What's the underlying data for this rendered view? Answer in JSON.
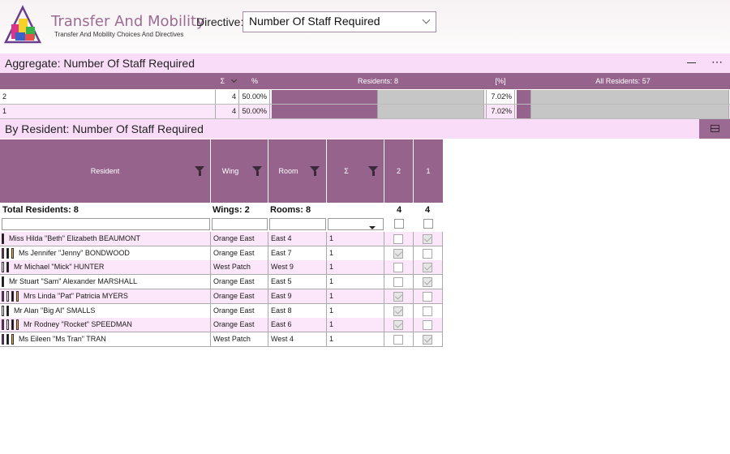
{
  "app": {
    "title": "Transfer And Mobility",
    "subtitle": "Transfer And Mobility Choices And Directives"
  },
  "directive": {
    "label": "Directive:",
    "value": "Number Of Staff Required"
  },
  "aggregate": {
    "title": "Aggregate: Number Of Staff Required",
    "headers": {
      "sum": "Σ",
      "pct": "%",
      "residents": "Residents: 8",
      "bracket_pct": "[%]",
      "all_residents": "All Residents: 57"
    },
    "rows": [
      {
        "key": "2",
        "count": "4",
        "pct": "50.00%",
        "share_residents": 0.5,
        "all_pct": "7.02%",
        "share_all": 0.0702
      },
      {
        "key": "1",
        "count": "4",
        "pct": "50.00%",
        "share_residents": 0.5,
        "all_pct": "7.02%",
        "share_all": 0.0702
      }
    ]
  },
  "by_resident": {
    "title": "By Resident: Number Of Staff Required",
    "headers": {
      "resident": "Resident",
      "wing": "Wing",
      "room": "Room",
      "sum": "Σ",
      "col2": "2",
      "col1": "1"
    },
    "totals": {
      "residents": "Total Residents: 8",
      "wings": "Wings: 2",
      "rooms": "Rooms: 8",
      "col2": "4",
      "col1": "4"
    },
    "rows": [
      {
        "name": "Miss Hilda \"Beth\" Elizabeth BEAUMONT",
        "wing": "Orange East",
        "room": "East  4",
        "sum": "1",
        "c2": false,
        "c1": true,
        "tags": [
          "#111111"
        ]
      },
      {
        "name": "Ms Jennifer \"Jenny\" BONDWOOD",
        "wing": "Orange East",
        "room": "East  7",
        "sum": "1",
        "c2": true,
        "c1": false,
        "tags": [
          "#7a2a7a",
          "#111111",
          "#f0a830"
        ]
      },
      {
        "name": "Mr Michael \"Mick\" HUNTER",
        "wing": "West Patch",
        "room": "West  9",
        "sum": "1",
        "c2": false,
        "c1": true,
        "tags": [
          "#ffffff",
          "#111111"
        ]
      },
      {
        "name": "Mr Stuart \"Sam\" Alexander MARSHALL",
        "wing": "Orange East",
        "room": "East  5",
        "sum": "1",
        "c2": false,
        "c1": true,
        "tags": [
          "#111111"
        ]
      },
      {
        "name": "Mrs Linda \"Pat\" Patricia MYERS",
        "wing": "Orange East",
        "room": "East  9",
        "sum": "1",
        "c2": true,
        "c1": false,
        "tags": [
          "#7a2a7a",
          "#ffffff",
          "#111111",
          "#f0a830"
        ]
      },
      {
        "name": "Mr Alan \"Big Al\" SMALLS",
        "wing": "Orange East",
        "room": "East  8",
        "sum": "1",
        "c2": true,
        "c1": false,
        "tags": [
          "#ffffff",
          "#111111"
        ]
      },
      {
        "name": "Mr Rodney \"Rocket\" SPEEDMAN",
        "wing": "Orange East",
        "room": "East  6",
        "sum": "1",
        "c2": true,
        "c1": false,
        "tags": [
          "#7a2a7a",
          "#ffffff",
          "#111111",
          "#f0a830"
        ]
      },
      {
        "name": "Ms Eileen \"Ms Tran\" TRAN",
        "wing": "West Patch",
        "room": "West  4",
        "sum": "1",
        "c2": false,
        "c1": true,
        "tags": [
          "#7a2a7a",
          "#111111",
          "#f0a830"
        ]
      }
    ]
  },
  "colors": {
    "accent": "#95638c",
    "section_bg": "#f9dcf7",
    "row_alt": "#fce6f9",
    "title": "#9c6b94"
  }
}
